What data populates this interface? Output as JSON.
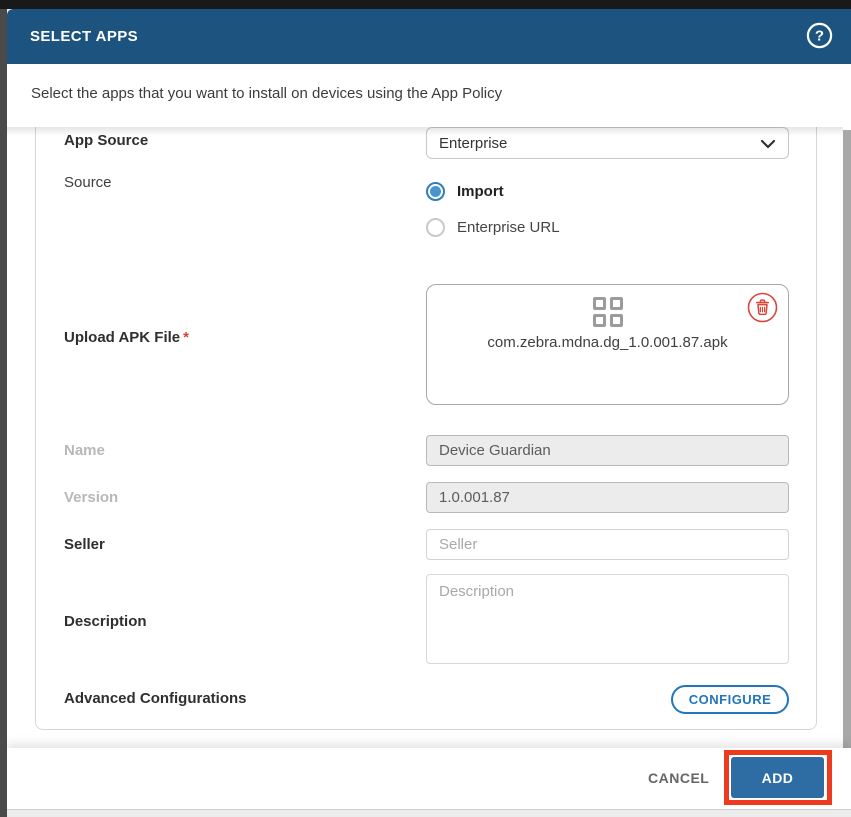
{
  "dialog": {
    "title": "SELECT APPS",
    "subtitle": "Select the apps that you want to install on devices using the App Policy",
    "help_icon": "question-mark-circle-icon"
  },
  "form": {
    "app_source": {
      "label": "App Source",
      "value": "Enterprise",
      "chevron_icon": "chevron-down-icon"
    },
    "source": {
      "label": "Source",
      "options": [
        {
          "label": "Import",
          "selected": true
        },
        {
          "label": "Enterprise URL",
          "selected": false
        }
      ]
    },
    "upload": {
      "label": "Upload APK File",
      "required_marker": "*",
      "file_name": "com.zebra.mdna.dg_1.0.001.87.apk",
      "placeholder_icon": "app-grid-icon",
      "delete_icon": "trash-icon"
    },
    "name": {
      "label": "Name",
      "value": "Device Guardian",
      "disabled": true
    },
    "version": {
      "label": "Version",
      "value": "1.0.001.87",
      "disabled": true
    },
    "seller": {
      "label": "Seller",
      "value": "",
      "placeholder": "Seller"
    },
    "description": {
      "label": "Description",
      "value": "",
      "placeholder": "Description"
    },
    "advanced": {
      "label": "Advanced Configurations",
      "button_label": "CONFIGURE"
    }
  },
  "footer": {
    "cancel_label": "CANCEL",
    "add_label": "ADD",
    "add_highlighted": true
  },
  "colors": {
    "header_bg": "#1d547f",
    "add_button_bg": "#2e6da4",
    "configure_blue": "#2176bd",
    "radio_selected_blue": "#4a93d1",
    "delete_red": "#d9463a",
    "required_red": "#e03c31",
    "highlight_annotation_red": "#ee3a1e",
    "scrollbar_grey": "#a8a8a8"
  }
}
